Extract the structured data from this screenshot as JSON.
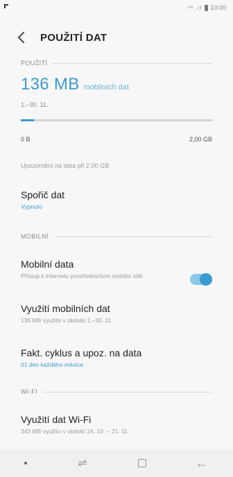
{
  "statusbar": {
    "signal": "⁴ᴳ .ıl",
    "time": "10:00"
  },
  "appbar": {
    "title": "POUŽITÍ DAT"
  },
  "usage": {
    "header": "POUŽITÍ",
    "amount": "136 MB",
    "unit": "mobilních dat",
    "range": "1.–30. 11.",
    "progress_fraction": 0.068,
    "scale_min": "0 B",
    "scale_max": "2,00 GB",
    "warning": "Upozornění na data při 2,00 GB"
  },
  "data_saver": {
    "title": "Spořič dat",
    "status": "Vypnuto"
  },
  "mobile_section": {
    "header": "MOBILNÍ"
  },
  "mobile_data": {
    "title": "Mobilní data",
    "subtitle": "Přístup k internetu prostřednictvím mobilní sítě.",
    "enabled": true
  },
  "mobile_usage": {
    "title": "Využití mobilních dat",
    "subtitle": "136 MB využito v období 1.–30. 11."
  },
  "billing": {
    "title": "Fakt. cyklus a upoz. na data",
    "subtitle": "01 den každého měsíce"
  },
  "wifi_section": {
    "header": "WI-FI"
  },
  "wifi_usage": {
    "title": "Využití dat Wi-Fi",
    "subtitle": "343 MB využito v období 24. 10. – 21. 11."
  },
  "colors": {
    "accent": "#3a9bd0",
    "toggle_track": "#8bc8e9"
  },
  "navbar": {
    "recent_icon": "⇌",
    "back_icon": "←"
  }
}
